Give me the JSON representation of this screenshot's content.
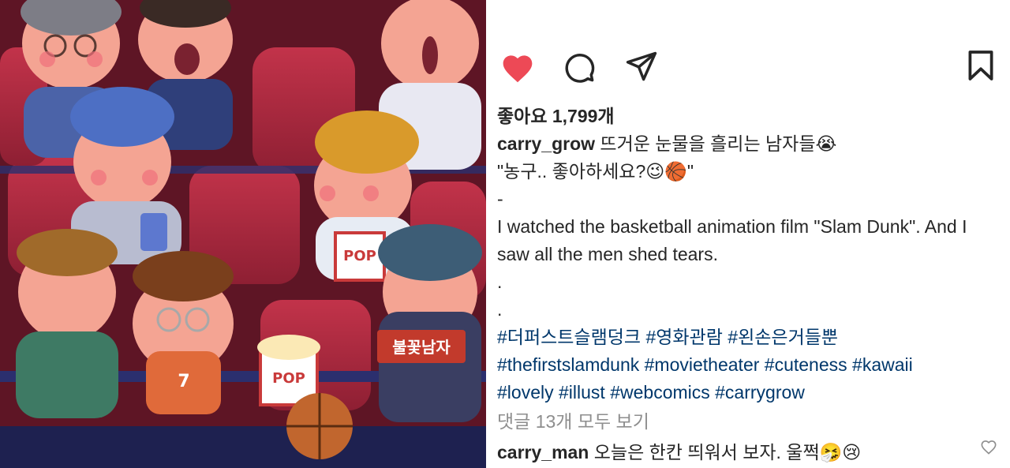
{
  "image": {
    "alt": "Illustration of men crying in a movie theater",
    "sign_text": "불꽃남자",
    "popcorn_text": "POP",
    "jersey_number": "7"
  },
  "actions": {
    "like_icon": "heart-filled-icon",
    "comment_icon": "comment-bubble-icon",
    "share_icon": "paper-plane-icon",
    "save_icon": "bookmark-icon",
    "like_color": "#ed4956"
  },
  "likes": {
    "text": "좋아요 1,799개"
  },
  "caption": {
    "username": "carry_grow",
    "title": " 뜨거운 눈물을 흘리는 남자들😭",
    "quote": "\"농구.. 좋아하세요?😉🏀\"",
    "dash": "-",
    "english": "I watched the basketball animation film \"Slam Dunk\". And I saw all the men shed tears.",
    "dot1": ".",
    "dot2": ".",
    "hashtags_line1": [
      "#더퍼스트슬램덩크",
      "#영화관람",
      "#왼손은거들뿐"
    ],
    "hashtags_line2": [
      "#thefirstslamdunk",
      "#movietheater",
      "#cuteness",
      "#kawaii"
    ],
    "hashtags_line3": [
      "#lovely",
      "#illust",
      "#webcomics",
      "#carrygrow"
    ]
  },
  "view_comments": "댓글 13개 모두 보기",
  "comment": {
    "username": "carry_man",
    "text": " 오늘은 한칸 띄워서 보자. 울쩍🤧😢"
  }
}
